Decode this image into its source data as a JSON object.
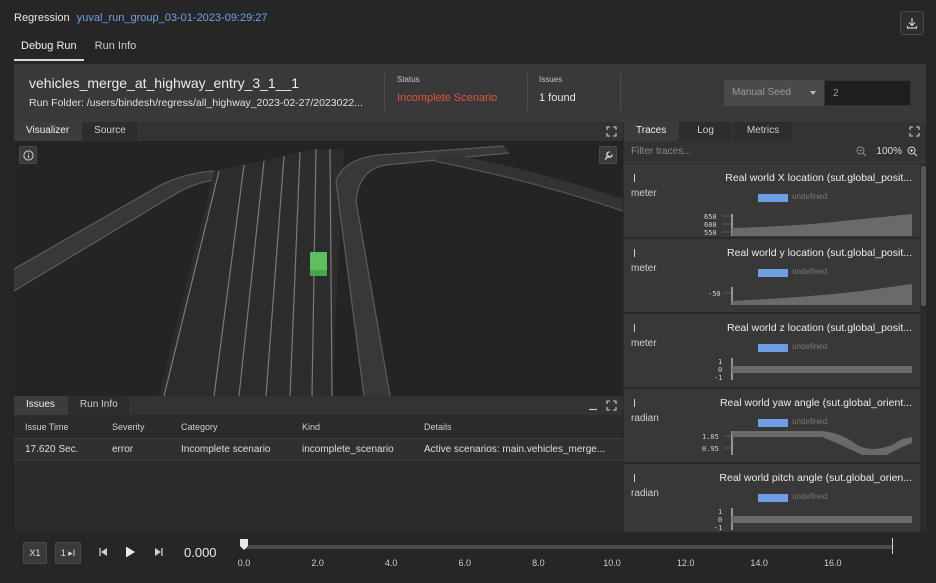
{
  "topbar": {
    "section": "Regression",
    "run_group": "yuval_run_group_03-01-2023-09:29:27"
  },
  "page_tabs": [
    "Debug Run",
    "Run Info"
  ],
  "header": {
    "title": "vehicles_merge_at_highway_entry_3_1__1",
    "folder": "Run Folder: /users/bindesh/regress/all_highway_2023-02-27/2023022...",
    "status_label": "Status",
    "status_value": "Incomplete Scenario",
    "issues_label": "Issues",
    "issues_value": "1 found",
    "seed_mode": "Manual Seed",
    "seed_value": "2",
    "status_color": "#e0533f"
  },
  "visualizer": {
    "tabs": [
      "Visualizer",
      "Source"
    ]
  },
  "issues_panel": {
    "tabs": [
      "Issues",
      "Run Info"
    ],
    "columns": [
      "Issue Time",
      "Severity",
      "Category",
      "Kind",
      "Details"
    ],
    "rows": [
      [
        "17.620 Sec.",
        "error",
        "Incomplete scenario",
        "incomplete_scenario",
        "Active scenarios: main.vehicles_merge..."
      ]
    ]
  },
  "traces_panel": {
    "tabs": [
      "Traces",
      "Log",
      "Metrics"
    ],
    "filter_placeholder": "Filter traces...",
    "zoom": "100%",
    "legend_label": "undefined",
    "traces": [
      {
        "name": "Real world X location (sut.global_posit...",
        "unit": "meter",
        "ticks": [
          "650",
          "600",
          "550"
        ]
      },
      {
        "name": "Real world y location (sut.global_posit...",
        "unit": "meter",
        "ticks": [
          "-50"
        ]
      },
      {
        "name": "Real world z location (sut.global_posit...",
        "unit": "meter",
        "ticks": [
          "1",
          "0",
          "-1"
        ]
      },
      {
        "name": "Real world yaw angle (sut.global_orient...",
        "unit": "radian",
        "ticks": [
          "1.05",
          "0.95"
        ]
      },
      {
        "name": "Real world pitch angle (sut.global_orien...",
        "unit": "radian",
        "ticks": [
          "1",
          "0",
          "-1"
        ]
      }
    ]
  },
  "player": {
    "speed": "X1",
    "step": "1 ▸I",
    "time": "0.000",
    "ticks": [
      "0.0",
      "2.0",
      "4.0",
      "6.0",
      "8.0",
      "10.0",
      "12.0",
      "14.0",
      "16.0"
    ]
  }
}
